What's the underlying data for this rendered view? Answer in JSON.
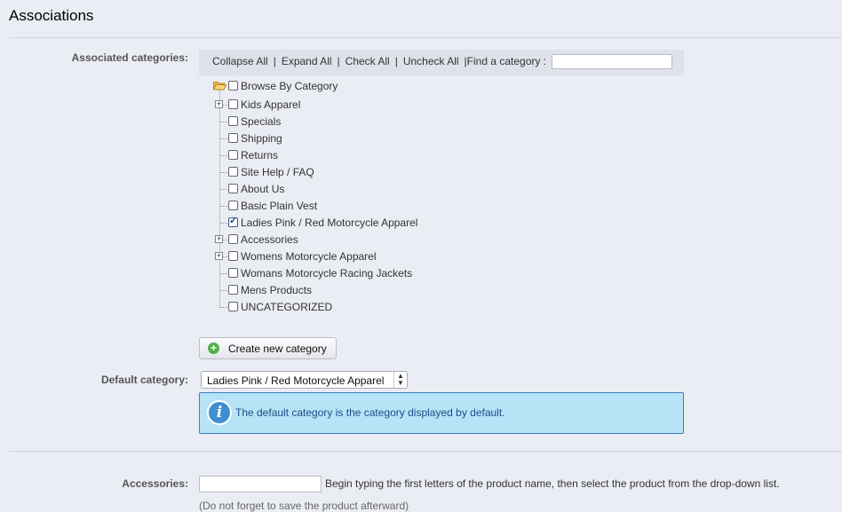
{
  "section": {
    "title": "Associations"
  },
  "associated_categories": {
    "label": "Associated categories:",
    "toolbar": {
      "collapse_all": "Collapse All",
      "expand_all": "Expand All",
      "check_all": "Check All",
      "uncheck_all": "Uncheck All",
      "find_label": "Find a category :",
      "find_value": ""
    },
    "tree": {
      "root": "Browse By Category",
      "items": [
        {
          "label": "Kids Apparel",
          "expandable": true,
          "checked": false
        },
        {
          "label": "Specials",
          "expandable": false,
          "checked": false
        },
        {
          "label": "Shipping",
          "expandable": false,
          "checked": false
        },
        {
          "label": "Returns",
          "expandable": false,
          "checked": false
        },
        {
          "label": "Site Help / FAQ",
          "expandable": false,
          "checked": false
        },
        {
          "label": "About Us",
          "expandable": false,
          "checked": false
        },
        {
          "label": "Basic Plain Vest",
          "expandable": false,
          "checked": false
        },
        {
          "label": "Ladies Pink / Red Motorcycle Apparel",
          "expandable": false,
          "checked": true
        },
        {
          "label": "Accessories",
          "expandable": true,
          "checked": false
        },
        {
          "label": "Womens Motorcycle Apparel",
          "expandable": true,
          "checked": false
        },
        {
          "label": "Womans Motorcycle Racing Jackets",
          "expandable": false,
          "checked": false
        },
        {
          "label": "Mens Products",
          "expandable": false,
          "checked": false
        },
        {
          "label": "UNCATEGORIZED",
          "expandable": false,
          "checked": false
        }
      ]
    },
    "create_button": "Create new category"
  },
  "default_category": {
    "label": "Default category:",
    "selected": "Ladies Pink / Red Motorcycle Apparel",
    "info": "The default category is the category displayed by default."
  },
  "accessories": {
    "label": "Accessories:",
    "value": "",
    "help": "Begin typing the first letters of the product name, then select the product from the drop-down list.",
    "note": "(Do not forget to save the product afterward)"
  },
  "colors": {
    "page_bg": "#ebedf4",
    "info_bg": "#b6e3f5",
    "info_border": "#3a7fbf",
    "info_text": "#1e4d8c"
  }
}
